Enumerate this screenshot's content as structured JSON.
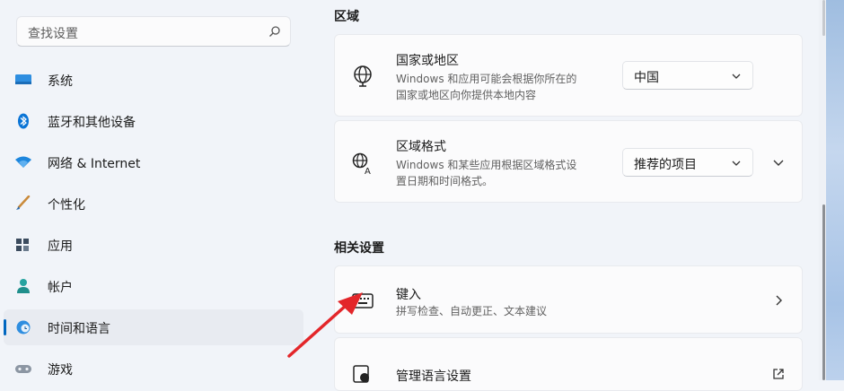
{
  "sidebar": {
    "search_placeholder": "查找设置",
    "items": [
      {
        "label": "系统",
        "icon": "monitor-icon",
        "active": false
      },
      {
        "label": "蓝牙和其他设备",
        "icon": "bluetooth-icon",
        "active": false
      },
      {
        "label": "网络 & Internet",
        "icon": "wifi-icon",
        "active": false
      },
      {
        "label": "个性化",
        "icon": "brush-icon",
        "active": false
      },
      {
        "label": "应用",
        "icon": "apps-icon",
        "active": false
      },
      {
        "label": "帐户",
        "icon": "person-icon",
        "active": false
      },
      {
        "label": "时间和语言",
        "icon": "globe-clock-icon",
        "active": true
      },
      {
        "label": "游戏",
        "icon": "gamepad-icon",
        "active": false
      }
    ]
  },
  "main": {
    "region_section": {
      "title": "区域",
      "country": {
        "title": "国家或地区",
        "subtitle": "Windows 和应用可能会根据你所在的\n国家或地区向你提供本地内容",
        "value": "中国"
      },
      "format": {
        "title": "区域格式",
        "subtitle": "Windows 和某些应用根据区域格式设\n置日期和时间格式。",
        "value": "推荐的项目"
      }
    },
    "related_section": {
      "title": "相关设置",
      "typing": {
        "title": "键入",
        "subtitle": "拼写检查、自动更正、文本建议"
      },
      "language_admin": {
        "title": "管理语言设置"
      }
    }
  },
  "colors": {
    "accent": "#0067c0",
    "annotation_arrow": "#e3262a"
  }
}
